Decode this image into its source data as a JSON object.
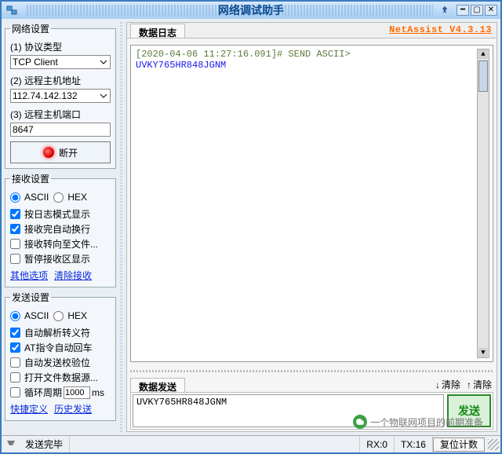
{
  "titlebar": {
    "title": "网络调试助手"
  },
  "brand": "NetAssist V4.3.13",
  "network": {
    "legend": "网络设置",
    "proto_label": "(1) 协议类型",
    "proto_value": "TCP Client",
    "host_label": "(2) 远程主机地址",
    "host_value": "112.74.142.132",
    "port_label": "(3) 远程主机端口",
    "port_value": "8647",
    "disconnect": "断开"
  },
  "recv": {
    "legend": "接收设置",
    "ascii": "ASCII",
    "hex": "HEX",
    "opt1": "按日志模式显示",
    "opt2": "接收完自动换行",
    "opt3": "接收转向至文件...",
    "opt4": "暂停接收区显示",
    "link_more": "其他选项",
    "link_clear": "清除接收"
  },
  "send": {
    "legend": "发送设置",
    "ascii": "ASCII",
    "hex": "HEX",
    "opt1": "自动解析转义符",
    "opt2": "AT指令自动回车",
    "opt3": "自动发送校验位",
    "opt4": "打开文件数据源...",
    "cycle_label": "循环周期",
    "cycle_value": "1000",
    "cycle_unit": "ms",
    "link_shortcut": "快捷定义",
    "link_history": "历史发送"
  },
  "log": {
    "tab": "数据日志",
    "timestamp": "[2020-04-06 11:27:16.091]# SEND ASCII>",
    "data": "UVKY765HR848JGNM"
  },
  "sendzone": {
    "tab": "数据发送",
    "clear": "清除",
    "clear2": "清除",
    "value": "UVKY765HR848JGNM",
    "button": "发送"
  },
  "status": {
    "ready": "发送完毕",
    "rx": "RX:0",
    "tx": "TX:16",
    "reset": "复位计数"
  },
  "watermark": "一个物联网项目的前期准备"
}
